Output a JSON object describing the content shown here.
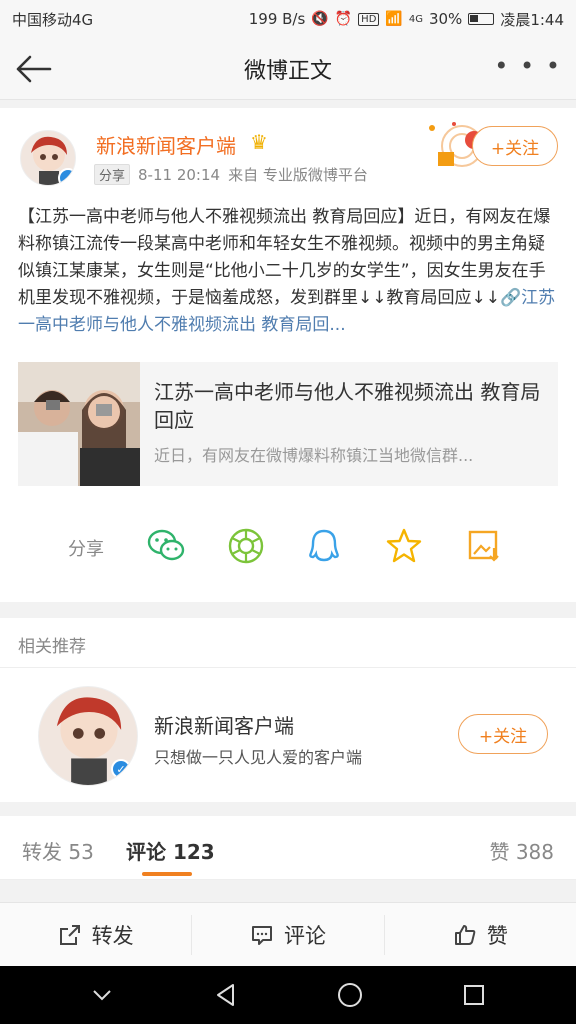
{
  "status_bar": {
    "carrier": "中国移动4G",
    "speed": "199 B/s",
    "signal": "4G",
    "battery": "30%",
    "time": "凌晨1:44"
  },
  "nav": {
    "title": "微博正文",
    "more": "• • •"
  },
  "post": {
    "author": "新浪新闻客户端",
    "share_tag": "分享",
    "time": "8-11 20:14",
    "source": "来自 专业版微博平台",
    "follow_label": "+关注",
    "text": "【江苏一高中老师与他人不雅视频流出 教育局回应】近日，有网友在爆料称镇江流传一段某高中老师和年轻女生不雅视频。视频中的男主角疑似镇江某康某，女生则是“比他小二十几岁的女学生”，因女生男友在手机里发现不雅视频，于是恼羞成怒，发到群里↓↓教育局回应↓↓",
    "link_text": "🔗江苏一高中老师与他人不雅视频流出 教育局回...",
    "card": {
      "title": "江苏一高中老师与他人不雅视频流出 教育局回应",
      "desc": "近日，有网友在微博爆料称镇江当地微信群..."
    },
    "share_label": "分享"
  },
  "related": {
    "label": "相关推荐",
    "name": "新浪新闻客户端",
    "desc": "只想做一只人见人爱的客户端",
    "follow_label": "+关注"
  },
  "tabs": {
    "repost": "转发 53",
    "comment": "评论 123",
    "like": "赞 388"
  },
  "actions": {
    "repost": "转发",
    "comment": "评论",
    "like": "赞"
  },
  "colors": {
    "accent": "#f08020",
    "link": "#507daf",
    "verified": "#2b8ce0"
  }
}
